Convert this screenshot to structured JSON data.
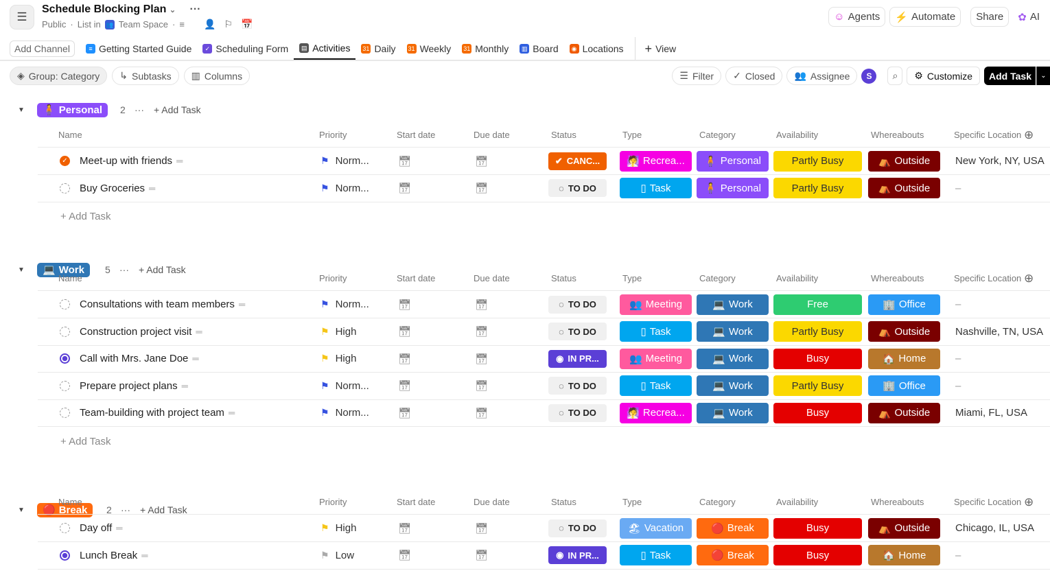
{
  "header": {
    "title": "Schedule Blocking Plan",
    "visibility": "Public",
    "list_in": "List in",
    "space": "Team Space",
    "agents": "Agents",
    "automate": "Automate",
    "share": "Share",
    "ai": "AI"
  },
  "tabs": {
    "add_channel": "Add Channel",
    "items": [
      "Getting Started Guide",
      "Scheduling Form",
      "Activities",
      "Daily",
      "Weekly",
      "Monthly",
      "Board",
      "Locations"
    ],
    "add_view": "View"
  },
  "toolbar": {
    "group": "Group: Category",
    "subtasks": "Subtasks",
    "columns": "Columns",
    "filter": "Filter",
    "closed": "Closed",
    "assignee": "Assignee",
    "avatar": "S",
    "customize": "Customize",
    "add_task": "Add Task"
  },
  "columns": [
    "Name",
    "Priority",
    "Start date",
    "Due date",
    "Status",
    "Type",
    "Category",
    "Availability",
    "Whereabouts",
    "Specific Location"
  ],
  "add_task": "Add Task",
  "colors": {
    "Personal": "#8b4dfa",
    "Work": "#2f77b5",
    "Break": "#ff6a0f",
    "Recreation": "#f600e3",
    "Task": "#00a6ef",
    "Meeting": "#ff5a9e",
    "Vacation": "#6aaaf3",
    "Free": "#2ecc71",
    "Busy": "#e40000",
    "Partly Busy": "#fbd800",
    "Outside": "#7a0000",
    "Office": "#2a9af5",
    "Home": "#b8782c"
  },
  "groups": [
    {
      "label": "Personal",
      "icon": "🧍",
      "count": "2",
      "tasks": [
        {
          "name": "Meet-up with friends",
          "state": "canc",
          "priority": "Norm...",
          "flag": "#3652e0",
          "status": "CANC...",
          "type": "Recrea...",
          "type_key": "Recreation",
          "type_icon": "🧖",
          "category": "Personal",
          "cat_icon": "🧍",
          "availability": "Partly Busy",
          "whereabouts": "Outside",
          "where_icon": "⛺",
          "location": "New York, NY, USA"
        },
        {
          "name": "Buy Groceries",
          "state": "todo",
          "priority": "Norm...",
          "flag": "#3652e0",
          "status": "TO DO",
          "type": "Task",
          "type_key": "Task",
          "type_icon": "▯",
          "category": "Personal",
          "cat_icon": "🧍",
          "availability": "Partly Busy",
          "whereabouts": "Outside",
          "where_icon": "⛺",
          "location": "–"
        }
      ]
    },
    {
      "label": "Work",
      "icon": "💻",
      "count": "5",
      "tasks": [
        {
          "name": "Consultations with team members",
          "state": "todo",
          "priority": "Norm...",
          "flag": "#3652e0",
          "status": "TO DO",
          "type": "Meeting",
          "type_key": "Meeting",
          "type_icon": "👥",
          "category": "Work",
          "cat_icon": "💻",
          "availability": "Free",
          "whereabouts": "Office",
          "where_icon": "🏢",
          "location": "–"
        },
        {
          "name": "Construction project visit",
          "state": "todo",
          "priority": "High",
          "flag": "#f5c518",
          "status": "TO DO",
          "type": "Task",
          "type_key": "Task",
          "type_icon": "▯",
          "category": "Work",
          "cat_icon": "💻",
          "availability": "Partly Busy",
          "whereabouts": "Outside",
          "where_icon": "⛺",
          "location": "Nashville, TN, USA"
        },
        {
          "name": "Call with Mrs. Jane Doe",
          "state": "prog",
          "priority": "High",
          "flag": "#f5c518",
          "status": "IN PR...",
          "type": "Meeting",
          "type_key": "Meeting",
          "type_icon": "👥",
          "category": "Work",
          "cat_icon": "💻",
          "availability": "Busy",
          "whereabouts": "Home",
          "where_icon": "🏠",
          "location": "–"
        },
        {
          "name": "Prepare project plans",
          "state": "todo",
          "priority": "Norm...",
          "flag": "#3652e0",
          "status": "TO DO",
          "type": "Task",
          "type_key": "Task",
          "type_icon": "▯",
          "category": "Work",
          "cat_icon": "💻",
          "availability": "Partly Busy",
          "whereabouts": "Office",
          "where_icon": "🏢",
          "location": "–"
        },
        {
          "name": "Team-building with project team",
          "state": "todo",
          "priority": "Norm...",
          "flag": "#3652e0",
          "status": "TO DO",
          "type": "Recrea...",
          "type_key": "Recreation",
          "type_icon": "🧖",
          "category": "Work",
          "cat_icon": "💻",
          "availability": "Busy",
          "whereabouts": "Outside",
          "where_icon": "⛺",
          "location": "Miami, FL, USA"
        }
      ]
    },
    {
      "label": "Break",
      "icon": "🔴",
      "count": "2",
      "tasks": [
        {
          "name": "Day off",
          "state": "todo",
          "priority": "High",
          "flag": "#f5c518",
          "status": "TO DO",
          "type": "Vacation",
          "type_key": "Vacation",
          "type_icon": "🏖",
          "category": "Break",
          "cat_icon": "🔴",
          "availability": "Busy",
          "whereabouts": "Outside",
          "where_icon": "⛺",
          "location": "Chicago, IL, USA"
        },
        {
          "name": "Lunch Break",
          "state": "prog",
          "priority": "Low",
          "flag": "#aaaaaa",
          "status": "IN PR...",
          "type": "Task",
          "type_key": "Task",
          "type_icon": "▯",
          "category": "Break",
          "cat_icon": "🔴",
          "availability": "Busy",
          "whereabouts": "Home",
          "where_icon": "🏠",
          "location": "–"
        }
      ]
    }
  ]
}
